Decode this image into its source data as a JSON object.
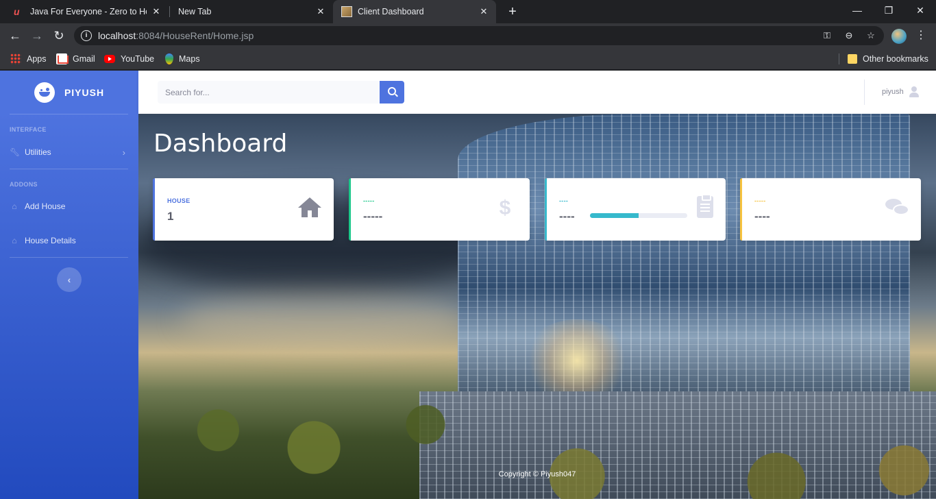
{
  "browser": {
    "tabs": [
      {
        "title": "Java For Everyone - Zero to Hero",
        "active": false
      },
      {
        "title": "New Tab",
        "active": false
      },
      {
        "title": "Client Dashboard",
        "active": true
      }
    ],
    "address": {
      "host": "localhost",
      "path": ":8084/HouseRent/Home.jsp"
    },
    "bookmarks": [
      {
        "label": "Apps",
        "icon": "apps-grid-icon"
      },
      {
        "label": "Gmail",
        "icon": "gmail-icon"
      },
      {
        "label": "YouTube",
        "icon": "youtube-icon"
      },
      {
        "label": "Maps",
        "icon": "maps-icon"
      }
    ],
    "other_bookmarks": "Other bookmarks"
  },
  "sidebar": {
    "brand": "PIYUSH",
    "sections": [
      {
        "heading": "INTERFACE",
        "items": [
          {
            "label": "Utilities",
            "icon": "wrench-icon",
            "expandable": true
          }
        ]
      },
      {
        "heading": "ADDONS",
        "items": [
          {
            "label": "Add House",
            "icon": "home-icon"
          },
          {
            "label": "House Details",
            "icon": "home-icon"
          }
        ]
      }
    ]
  },
  "topbar": {
    "search_placeholder": "Search for...",
    "user_name": "piyush"
  },
  "main": {
    "title": "Dashboard",
    "cards": [
      {
        "label": "HOUSE",
        "value": "1",
        "icon": "home-icon",
        "accent": "#4e73df"
      },
      {
        "label": "-----",
        "value": "-----",
        "icon": "dollar-icon",
        "accent": "#1cc88a"
      },
      {
        "label": "----",
        "value": "----",
        "icon": "clipboard-icon",
        "accent": "#36b9cc",
        "progress": 0.5
      },
      {
        "label": "-----",
        "value": "----",
        "icon": "comments-icon",
        "accent": "#f6c23e"
      }
    ],
    "footer": "Copyright © Piyush047"
  }
}
